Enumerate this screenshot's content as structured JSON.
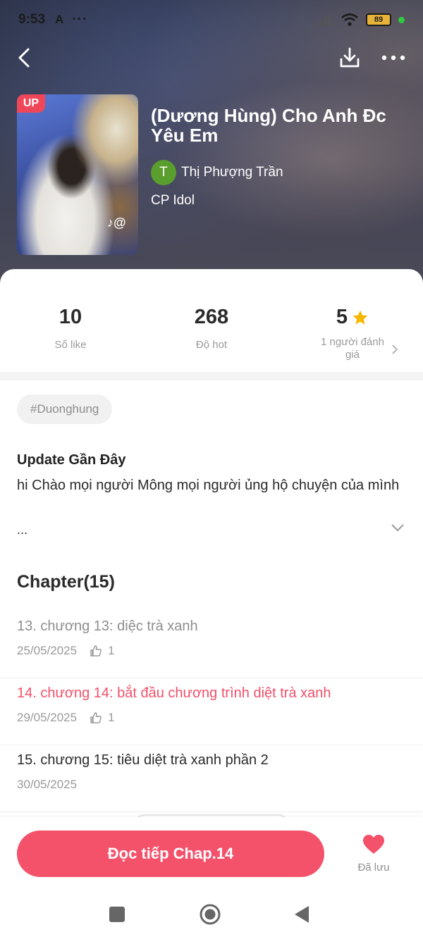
{
  "status_bar": {
    "time": "9:53",
    "a_indicator": "A",
    "overflow": "···",
    "battery": "89"
  },
  "header": {
    "up_badge": "UP",
    "title": "(Dương Hùng) Cho Anh Đc Yêu Em",
    "author_initial": "T",
    "author_name": "Thị Phượng Trần",
    "category": "CP Idol"
  },
  "stats": {
    "likes_value": "10",
    "likes_label": "Số like",
    "hot_value": "268",
    "hot_label": "Độ hot",
    "rating_value": "5",
    "rating_label": "1 người đánh giá"
  },
  "hashtag": "#Duonghung",
  "update": {
    "title": "Update Gần Đây",
    "text": "hi Chào mọi người Mông mọi người ủng hộ chuyện của mình",
    "more": "..."
  },
  "chapters": {
    "heading": "Chapter(15)",
    "items": [
      {
        "title": "13. chương 13: diệc trà xanh",
        "date": "25/05/2025",
        "likes": "1"
      },
      {
        "title": "14. chương 14: bắt đầu chương trình diệt trà xanh",
        "date": "29/05/2025",
        "likes": "1"
      },
      {
        "title": "15. chương 15: tiêu diệt trà xanh phần 2",
        "date": "30/05/2025"
      }
    ]
  },
  "bottom": {
    "read_button": "Đọc tiếp Chap.14",
    "saved_label": "Đã lưu"
  },
  "colors": {
    "accent": "#f4526b",
    "badge": "#f0465a",
    "star": "#f5b800",
    "author_avatar": "#5a9e2e"
  },
  "icons": {
    "back": "back-arrow-icon",
    "download": "download-icon",
    "more": "more-dots-icon",
    "rating": "star-icon",
    "like": "thumbs-up-icon",
    "saved": "heart-icon",
    "expand": "chevron-down-icon"
  }
}
